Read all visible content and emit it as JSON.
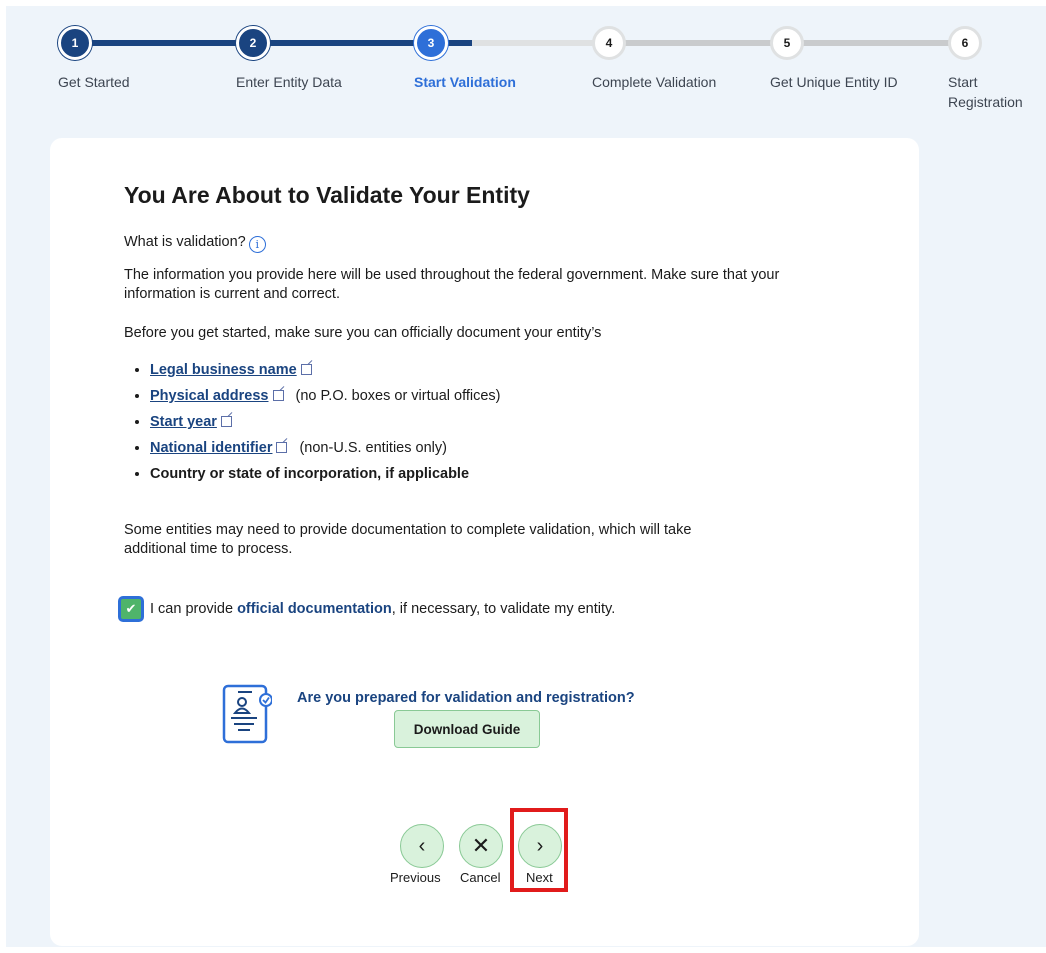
{
  "stepper": {
    "steps": [
      {
        "number": "1",
        "label": "Get Started",
        "state": "done"
      },
      {
        "number": "2",
        "label": "Enter Entity Data",
        "state": "done"
      },
      {
        "number": "3",
        "label": "Start Validation",
        "state": "current"
      },
      {
        "number": "4",
        "label": "Complete Validation",
        "state": "todo"
      },
      {
        "number": "5",
        "label": "Get Unique Entity ID",
        "state": "todo"
      },
      {
        "number": "6",
        "label": "Start Registration",
        "state": "todo"
      }
    ],
    "colors": {
      "done": "#1a4480",
      "current": "#2e6fd8",
      "todo": "#dfe1e2"
    }
  },
  "main": {
    "title": "You Are About to Validate Your Entity",
    "what_is": "What is validation?",
    "intro": "The information you provide here will be used throughout the federal government. Make sure that your information is current and correct.",
    "before": "Before you get started, make sure you can officially document your entity’s",
    "items": [
      {
        "label": "Legal business name",
        "note": ""
      },
      {
        "label": "Physical address",
        "note": "(no P.O. boxes or virtual offices)"
      },
      {
        "label": "Start year",
        "note": ""
      },
      {
        "label": "National identifier",
        "note": "(non-U.S. entities only)"
      }
    ],
    "last_item": "Country or state of incorporation, if applicable",
    "documentation_note": "Some entities may need to provide documentation to complete validation, which will take additional time to process.",
    "checkbox": {
      "checked": true,
      "prefix": "I can provide ",
      "bold": "official documentation",
      "suffix": ", if necessary, to validate my entity."
    },
    "guide": {
      "question": "Are you prepared for validation and registration?",
      "button": "Download Guide"
    }
  },
  "nav": {
    "previous": "Previous",
    "cancel": "Cancel",
    "next": "Next"
  }
}
